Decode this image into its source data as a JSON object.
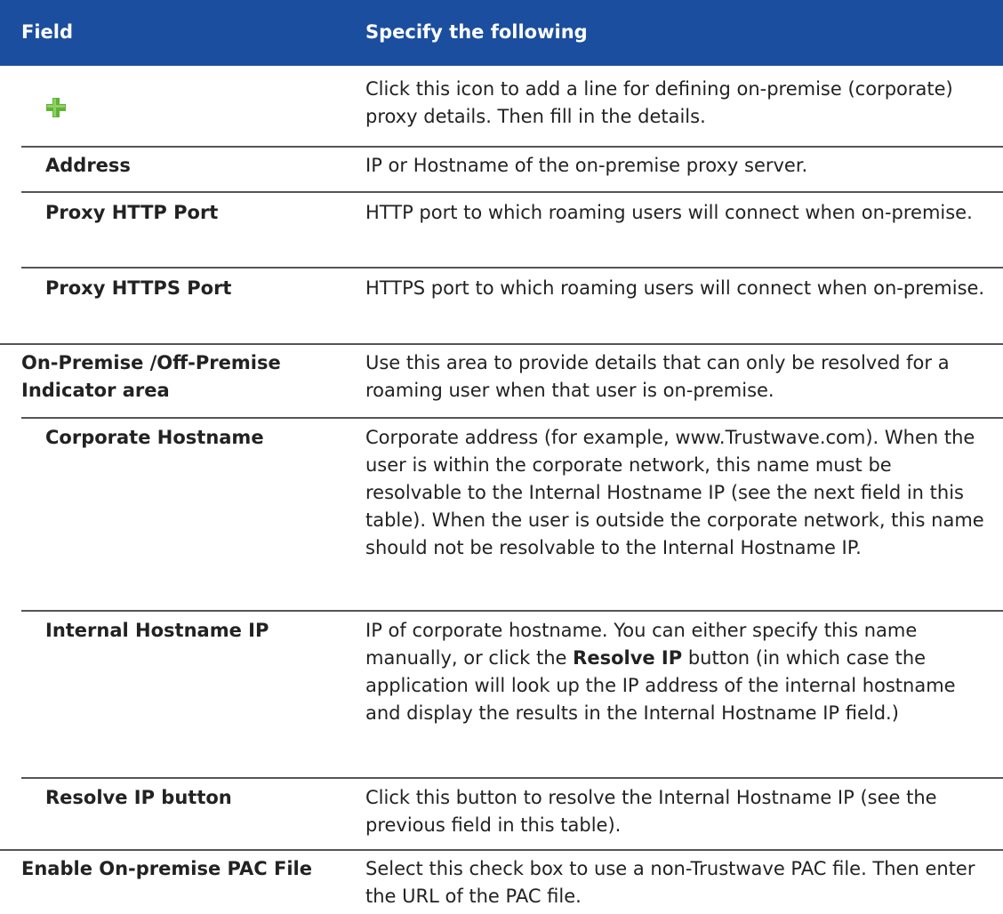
{
  "header": {
    "field_label": "Field",
    "spec_label": "Specify the following"
  },
  "rows": [
    {
      "field": "",
      "icon": "add-plus-icon",
      "description": "Click this icon to add a line for defining on-premise (corporate) proxy details. Then fill in the details."
    },
    {
      "field": "Address",
      "description": "IP or Hostname of the on-premise proxy server."
    },
    {
      "field": "Proxy HTTP Port",
      "description": "HTTP port to which roaming users will connect when on-premise."
    },
    {
      "field": "Proxy HTTPS Port",
      "description": "HTTPS port to which roaming users will connect when on-premise."
    },
    {
      "field": "On-Premise /Off-Premise Indicator area",
      "description": "Use this area to provide details that can only be resolved for a roaming user when that user is on-premise."
    },
    {
      "field": "Corporate Hostname",
      "description": "Corporate address (for example, www.Trustwave.com). When the user is within the corporate network, this name must be resolvable to the Internal Hostname IP (see the next field in this table). When the user is outside the corporate network, this name should not be resolvable to the Internal Hostname IP."
    },
    {
      "field": "Internal Hostname IP",
      "description_pre": "IP of corporate hostname. You can either specify this name manually, or click the ",
      "description_bold": "Resolve IP",
      "description_post": " button (in which case the application will look up the IP address of the internal hostname and display the results in the Internal Hostname IP field.)"
    },
    {
      "field": "Resolve IP button",
      "description": "Click this button to resolve the Internal Hostname IP (see the previous field in this table)."
    },
    {
      "field": "Enable On-premise PAC File",
      "description": "Select this check box to use a non-Trustwave PAC file. Then enter the URL of the PAC file."
    }
  ],
  "colors": {
    "header_bg": "#1b4e9e",
    "header_text": "#ffffff",
    "icon_green": "#5fb336"
  }
}
